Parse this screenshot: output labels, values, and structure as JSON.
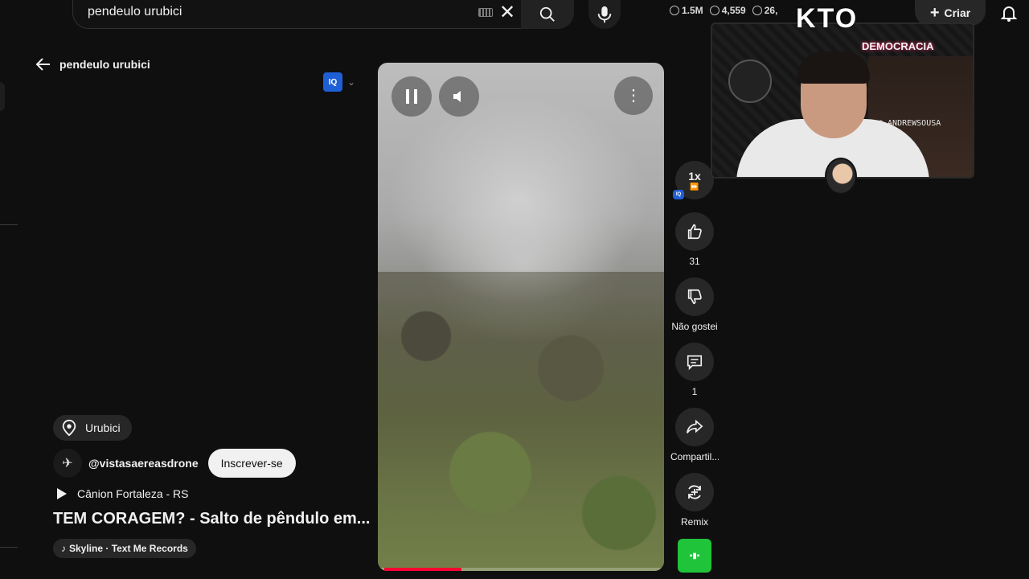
{
  "search": {
    "query": "pendeulo urubici"
  },
  "stats": {
    "views_total": "1.5M",
    "viewers": "4,559",
    "other": "26,"
  },
  "header": {
    "create_label": "Criar"
  },
  "page": {
    "back_label": "pendeulo urubici",
    "iq_label": "IQ"
  },
  "video": {
    "progress": 0.27
  },
  "actions": {
    "speed": "1x",
    "speed_badge": "IQ",
    "like_count": "31",
    "dislike_label": "Não gostei",
    "comment_count": "1",
    "share_label": "Compartil...",
    "remix_label": "Remix"
  },
  "meta": {
    "location": "Urubici",
    "channel": "@vistasaereasdrone",
    "subscribe_label": "Inscrever-se",
    "playlist": "Cânion Fortaleza - RS",
    "title": "TEM CORAGEM? - Salto de pêndulo em...",
    "music": "Skyline · Text Me Records"
  },
  "overlay": {
    "brand": "KTO",
    "neon_sign": "DEMOCRACIA",
    "instagram": "@_ANDREWSOUSA"
  },
  "colors": {
    "accent_red": "#ff0033",
    "iq_blue": "#1f5fd6",
    "music_green": "#1fc43a"
  }
}
